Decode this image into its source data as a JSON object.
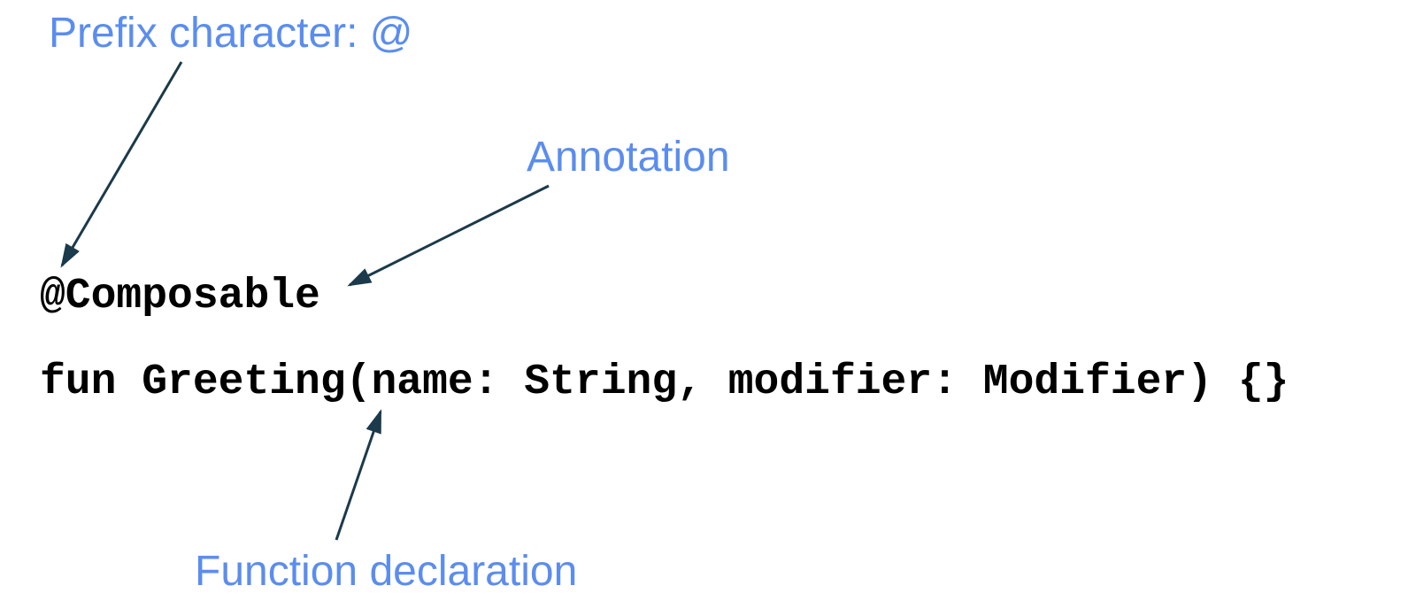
{
  "labels": {
    "prefix": "Prefix character: @",
    "annotation": "Annotation",
    "functionDeclaration": "Function declaration"
  },
  "code": {
    "annotationLine": "@Composable",
    "functionLine": "fun Greeting(name: String, modifier: Modifier) {}"
  },
  "colors": {
    "labelColor": "#5B8DEF",
    "arrowColor": "#1B3A4B"
  }
}
